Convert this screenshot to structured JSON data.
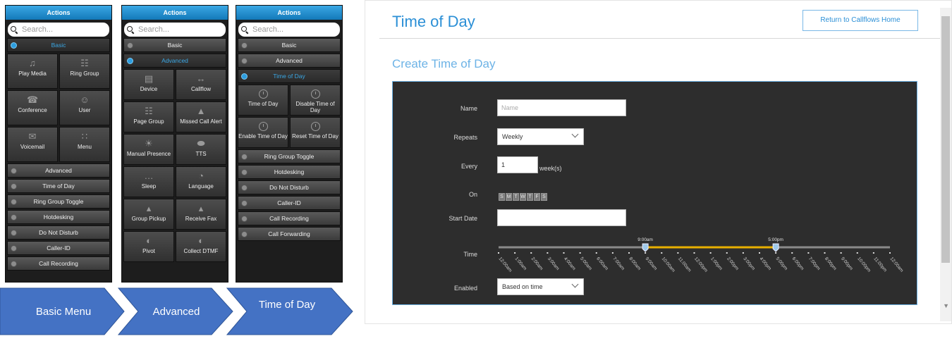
{
  "panel_header": "Actions",
  "search_placeholder": "Search...",
  "panels": [
    {
      "sections": [
        {
          "label": "Basic",
          "open": true,
          "tiles": [
            {
              "label": "Play Media",
              "icon": "music-note-icon"
            },
            {
              "label": "Ring Group",
              "icon": "ring-group-icon"
            },
            {
              "label": "Conference",
              "icon": "conference-icon"
            },
            {
              "label": "User",
              "icon": "user-icon"
            },
            {
              "label": "Voicemail",
              "icon": "voicemail-icon"
            },
            {
              "label": "Menu",
              "icon": "menu-grid-icon"
            }
          ]
        },
        {
          "label": "Advanced"
        },
        {
          "label": "Time of Day"
        },
        {
          "label": "Ring Group Toggle"
        },
        {
          "label": "Hotdesking"
        },
        {
          "label": "Do Not Disturb"
        },
        {
          "label": "Caller-ID"
        },
        {
          "label": "Call Recording"
        }
      ]
    },
    {
      "sections": [
        {
          "label": "Basic"
        },
        {
          "label": "Advanced",
          "open": true,
          "tiles": [
            {
              "label": "Device",
              "icon": "device-icon"
            },
            {
              "label": "Callflow",
              "icon": "callflow-icon"
            },
            {
              "label": "Page Group",
              "icon": "page-group-icon"
            },
            {
              "label": "Missed Call Alert",
              "icon": "alert-icon"
            },
            {
              "label": "Manual Presence",
              "icon": "presence-icon"
            },
            {
              "label": "TTS",
              "icon": "tts-icon"
            },
            {
              "label": "Sleep",
              "icon": "sleep-icon"
            },
            {
              "label": "Language",
              "icon": "language-icon"
            },
            {
              "label": "Group Pickup",
              "icon": "group-pickup-icon"
            },
            {
              "label": "Receive Fax",
              "icon": "fax-icon"
            },
            {
              "label": "Pivot",
              "icon": "pivot-icon"
            },
            {
              "label": "Collect DTMF",
              "icon": "dtmf-icon"
            }
          ]
        }
      ]
    },
    {
      "sections": [
        {
          "label": "Basic"
        },
        {
          "label": "Advanced"
        },
        {
          "label": "Time of Day",
          "open": true,
          "tiles": [
            {
              "label": "Time of Day",
              "icon": "alarm-clock-icon"
            },
            {
              "label": "Disable Time of Day",
              "icon": "alarm-clock-icon"
            },
            {
              "label": "Enable Time of Day",
              "icon": "alarm-clock-icon"
            },
            {
              "label": "Reset Time of Day",
              "icon": "alarm-clock-icon"
            }
          ]
        },
        {
          "label": "Ring Group Toggle"
        },
        {
          "label": "Hotdesking"
        },
        {
          "label": "Do Not Disturb"
        },
        {
          "label": "Caller-ID"
        },
        {
          "label": "Call Recording"
        },
        {
          "label": "Call Forwarding"
        }
      ]
    }
  ],
  "arrows": [
    "Basic Menu",
    "Advanced",
    "Time of Day"
  ],
  "tod": {
    "title": "Time of Day",
    "return_button": "Return to Callflows Home",
    "subtitle": "Create Time of Day",
    "name_label": "Name",
    "name_placeholder": "Name",
    "repeats_label": "Repeats",
    "repeats_value": "Weekly",
    "every_label": "Every",
    "every_value": "1",
    "every_unit": "week(s)",
    "on_label": "On",
    "days": [
      "S",
      "M",
      "T",
      "W",
      "T",
      "F",
      "S"
    ],
    "start_date_label": "Start Date",
    "time_label": "Time",
    "slider_start": "9:00am",
    "slider_end": "5:00pm",
    "slider_start_hour": 9,
    "slider_end_hour": 17,
    "hours": [
      "12:00am",
      "1:00am",
      "2:00am",
      "3:00am",
      "4:00am",
      "5:00am",
      "6:00am",
      "7:00am",
      "8:00am",
      "9:00am",
      "10:00am",
      "11:00am",
      "12:00pm",
      "1:00pm",
      "2:00pm",
      "3:00pm",
      "4:00pm",
      "5:00pm",
      "6:00pm",
      "7:00pm",
      "8:00pm",
      "9:00pm",
      "10:00pm",
      "11:00pm",
      "12:00am"
    ],
    "enabled_label": "Enabled",
    "enabled_value": "Based on time"
  },
  "colors": {
    "accent": "#2b8fd6",
    "arrow": "#4472c4",
    "slider_range": "#e8b000"
  }
}
